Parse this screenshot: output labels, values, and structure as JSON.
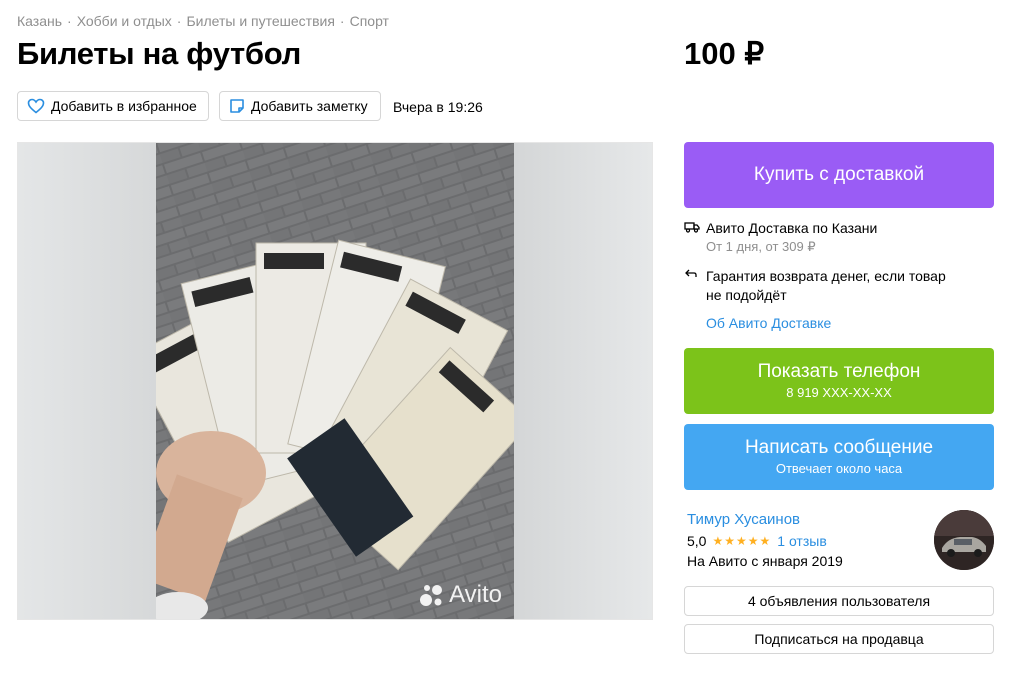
{
  "breadcrumbs": [
    "Казань",
    "Хобби и отдых",
    "Билеты и путешествия",
    "Спорт"
  ],
  "breadcrumb_separator": "·",
  "title": "Билеты на футбол",
  "price": "100 ₽",
  "actions": {
    "favorite_label": "Добавить в избранное",
    "note_label": "Добавить заметку",
    "posted": "Вчера в 19:26"
  },
  "gallery": {
    "watermark": "Avito"
  },
  "buy_button": "Купить с доставкой",
  "delivery": {
    "title": "Авито Доставка по Казани",
    "subtitle": "От 1 дня, от 309 ₽",
    "guarantee_line1": "Гарантия возврата денег, если товар",
    "guarantee_line2": "не подойдёт",
    "link": "Об Авито Доставке"
  },
  "phone_button": {
    "label": "Показать телефон",
    "number": "8 919 XXX-XX-XX"
  },
  "message_button": {
    "label": "Написать сообщение",
    "sub": "Отвечает около часа"
  },
  "seller": {
    "name": "Тимур Хусаинов",
    "rating": "5,0",
    "stars": "★★★★★",
    "reviews": "1 отзыв",
    "since": "На Авито с января 2019"
  },
  "seller_ads_button": "4 объявления пользователя",
  "subscribe_button": "Подписаться на продавца",
  "colors": {
    "buy": "#9a5cf5",
    "phone": "#7cc31a",
    "message": "#44a7f2",
    "link": "#2a8ee0",
    "star": "#ffb021"
  }
}
